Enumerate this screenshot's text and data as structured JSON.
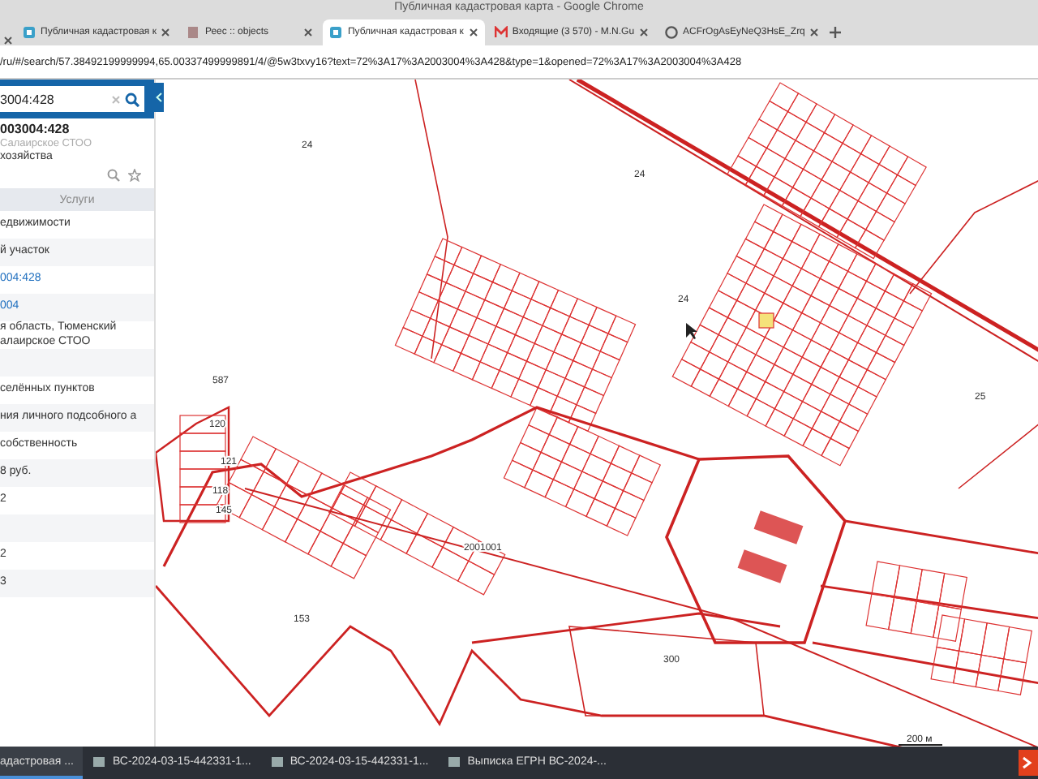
{
  "window": {
    "title": "Публичная кадастровая карта - Google Chrome"
  },
  "tabs": [
    {
      "label": "Публичная кадастровая к",
      "selected": false
    },
    {
      "label": "Реес :: objects",
      "selected": false
    },
    {
      "label": "Публичная кадастровая к",
      "selected": true
    },
    {
      "label": "Входящие (3 570) - M.N.Gu",
      "selected": false
    },
    {
      "label": "ACFrOgAsEyNeQ3HsE_Zrq",
      "selected": false
    }
  ],
  "address": "/ru/#/search/57.38492199999994,65.00337499999891/4/@5w3txvy16?text=72%3A17%3A2003004%3A428&type=1&opened=72%3A17%3A2003004%3A428",
  "panel": {
    "search": "3004:428",
    "number": "003004:428",
    "subtitle": "Салаирское СТОО",
    "category": "хозяйства",
    "section": "Услуги",
    "rows": [
      {
        "kind": "text",
        "text": "едвижимости"
      },
      {
        "kind": "text",
        "text": "й участок"
      },
      {
        "kind": "link",
        "text": "004:428"
      },
      {
        "kind": "link",
        "text": "004"
      },
      {
        "kind": "text",
        "text": "я область, Тюменский алаирское СТОО"
      },
      {
        "kind": "blank"
      },
      {
        "kind": "text",
        "text": "селённых пунктов"
      },
      {
        "kind": "text",
        "text": "ния личного подсобного а"
      },
      {
        "kind": "text",
        "text": "собственность"
      },
      {
        "kind": "text",
        "text": "8 руб."
      },
      {
        "kind": "text",
        "text": "2"
      },
      {
        "kind": "blank"
      },
      {
        "kind": "text",
        "text": "2"
      },
      {
        "kind": "text",
        "text": "3"
      }
    ]
  },
  "map": {
    "labels": [
      "24",
      "24",
      "24",
      "25",
      "587",
      "121",
      "120",
      "118",
      "145",
      "153",
      "300",
      "2001001"
    ],
    "scale": "200 м"
  },
  "taskbar": [
    {
      "label": "адастровая ...",
      "selected": true
    },
    {
      "label": "ВС-2024-03-15-442331-1...",
      "selected": false
    },
    {
      "label": "ВС-2024-03-15-442331-1...",
      "selected": false
    },
    {
      "label": "Выписка ЕГРН ВС-2024-...",
      "selected": false
    }
  ]
}
